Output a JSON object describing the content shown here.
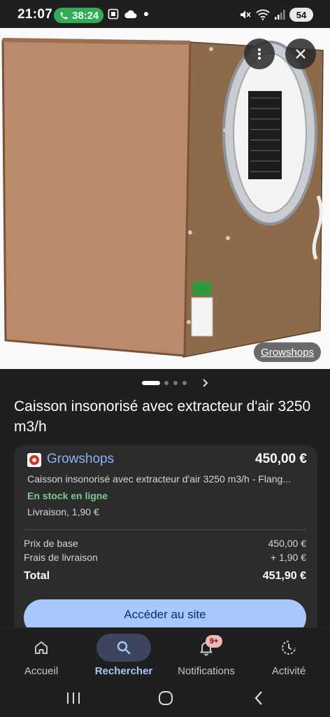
{
  "status_bar": {
    "time": "21:07",
    "call_timer": "38:24",
    "battery": "54",
    "icons": [
      "phone-icon",
      "screen-record-icon",
      "cloud-icon",
      "dot-icon",
      "mute-icon",
      "wifi-icon",
      "signal-icon"
    ]
  },
  "image_viewer": {
    "source_label": "Growshops",
    "more_button_icon": "more-vert-icon",
    "close_button_icon": "close-icon"
  },
  "pager": {
    "total_pages": 4,
    "current_page": 1,
    "next_icon": "chevron-right-icon"
  },
  "product": {
    "title": "Caisson insonorisé avec extracteur d'air 3250 m3/h"
  },
  "offer": {
    "shop_name": "Growshops",
    "price": "450,00 €",
    "description": "Caisson insonorisé avec extracteur d'air 3250 m3/h - Flang...",
    "stock_status": "En stock en ligne",
    "delivery": "Livraison, 1,90 €",
    "breakdown": {
      "base_price_label": "Prix de base",
      "base_price_value": "450,00 €",
      "shipping_label": "Frais de livraison",
      "shipping_value": "+ 1,90 €",
      "total_label": "Total",
      "total_value": "451,90 €"
    },
    "visit_button": "Accéder au site"
  },
  "bottom_nav": {
    "items": [
      {
        "label": "Accueil",
        "icon": "home-icon",
        "active": false
      },
      {
        "label": "Rechercher",
        "icon": "search-icon",
        "active": true
      },
      {
        "label": "Notifications",
        "icon": "bell-icon",
        "active": false,
        "badge": "9+"
      },
      {
        "label": "Activité",
        "icon": "activity-icon",
        "active": false
      }
    ]
  },
  "system_nav": {
    "icons": [
      "recents-icon",
      "home-circle-icon",
      "back-icon"
    ]
  },
  "colors": {
    "background": "#1f1f1f",
    "card": "#2c2c2c",
    "link_blue": "#8ab4f8",
    "stock_green": "#81c995",
    "button_blue": "#a8c7fa",
    "call_green": "#2eaf55"
  }
}
